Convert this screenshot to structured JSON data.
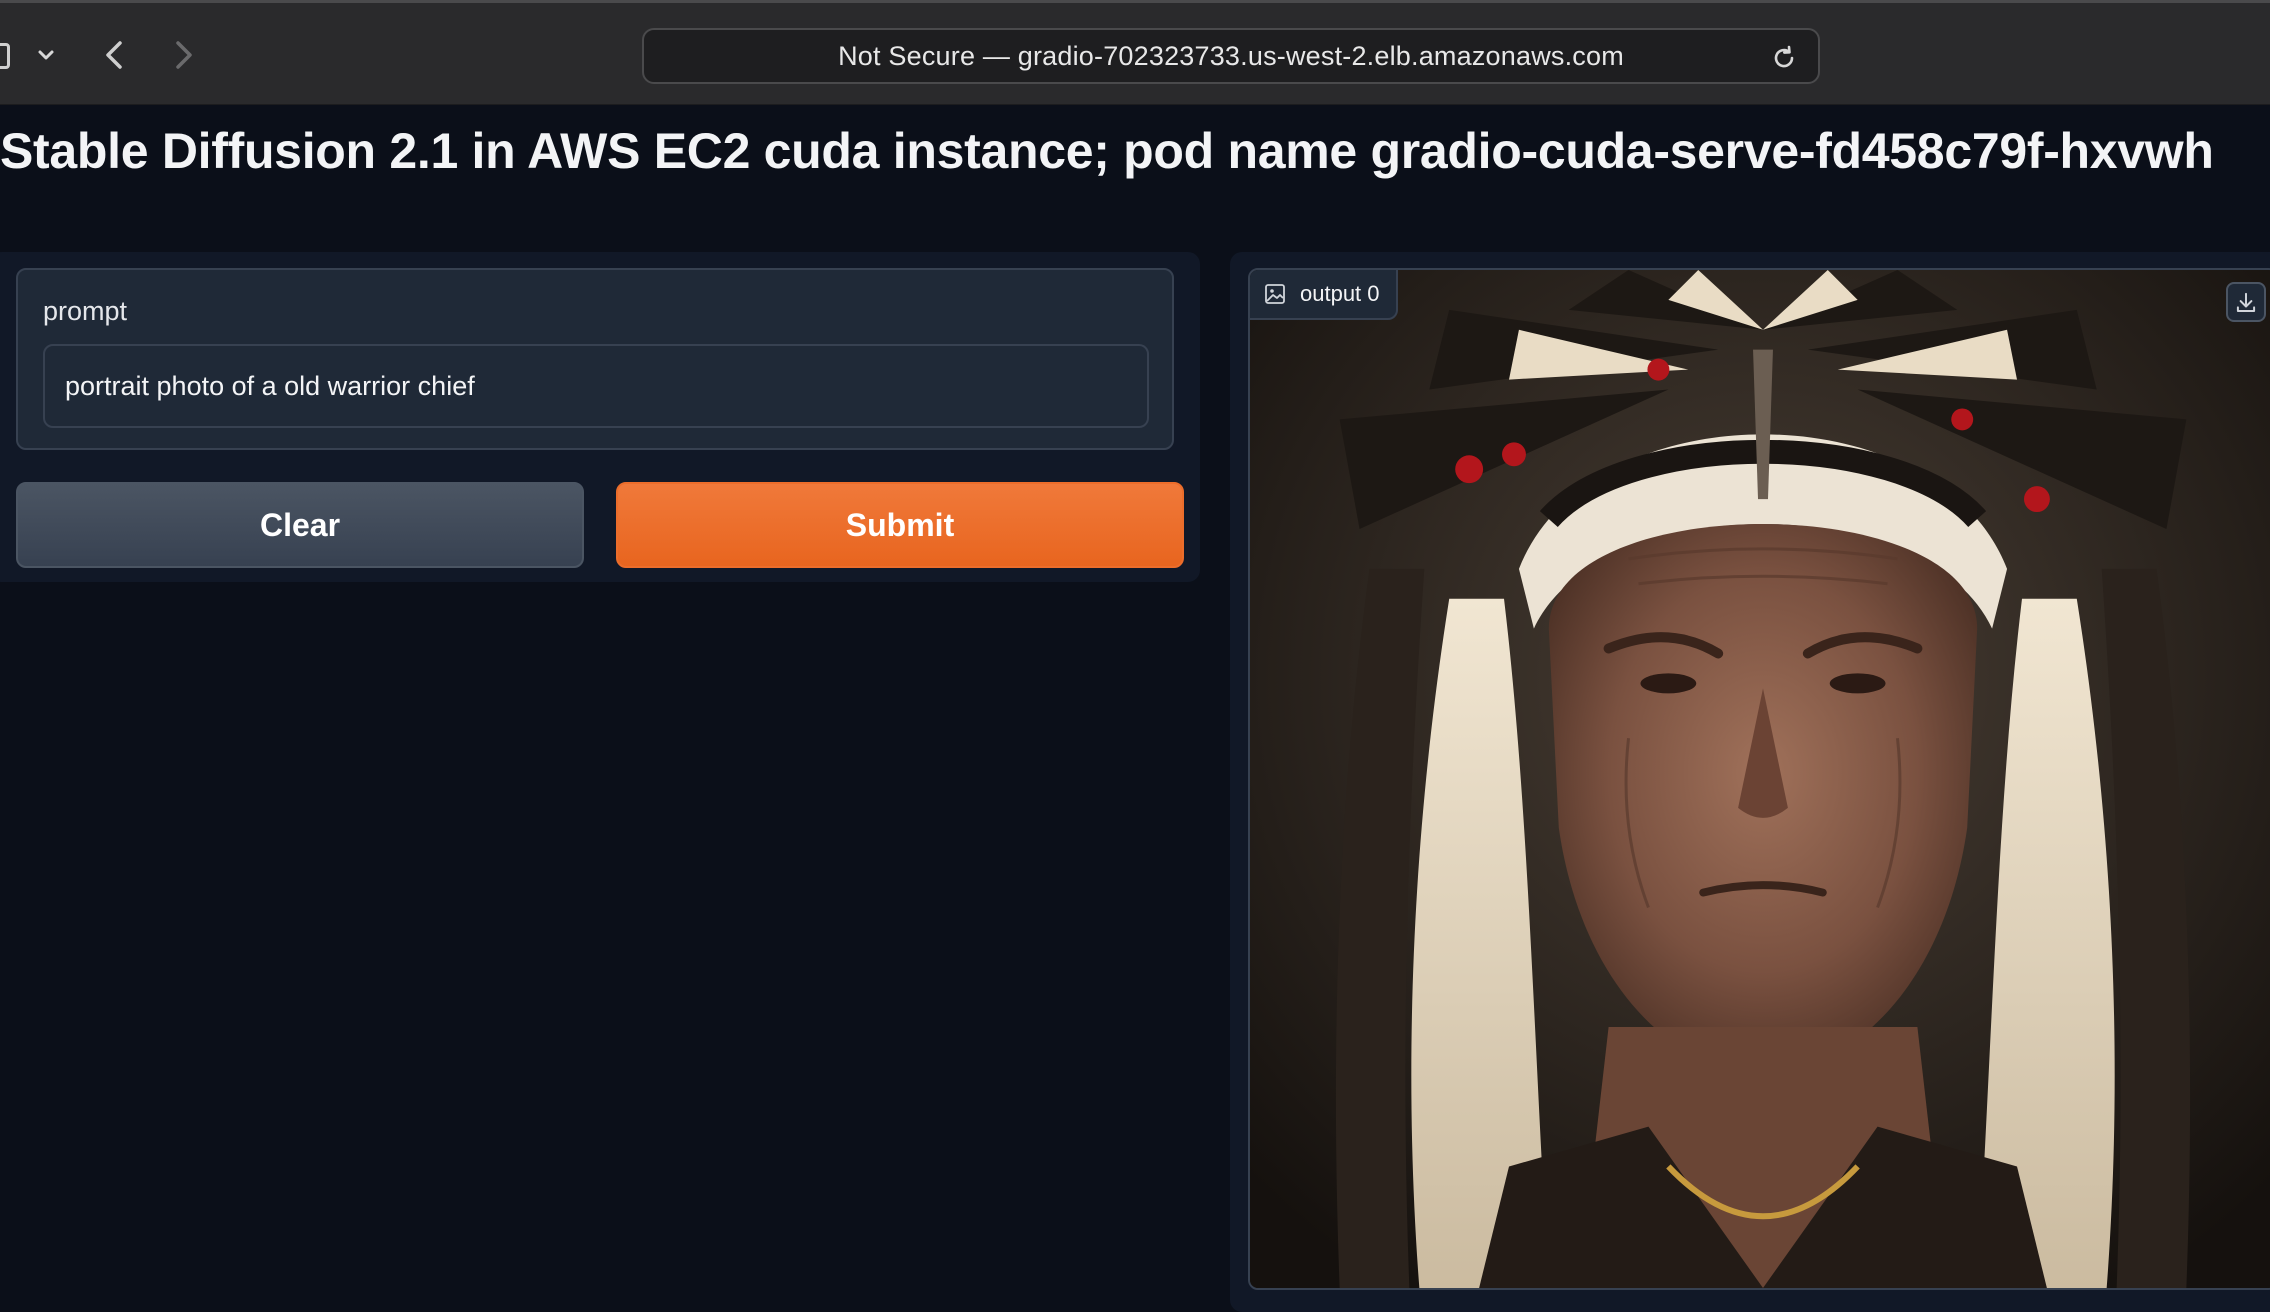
{
  "browser": {
    "url_text": "Not Secure — gradio-702323733.us-west-2.elb.amazonaws.com"
  },
  "page": {
    "title": "Stable Diffusion 2.1 in AWS EC2 cuda instance; pod name gradio-cuda-serve-fd458c79f-hxvwh"
  },
  "input_panel": {
    "prompt_label": "prompt",
    "prompt_value": "portrait photo of a old warrior chief",
    "clear_label": "Clear",
    "submit_label": "Submit"
  },
  "output_panel": {
    "label": "output 0",
    "image_subject": "portrait of an elderly man wearing a feathered headdress"
  },
  "colors": {
    "page_bg": "#0b0f19",
    "panel_bg": "#111827",
    "block_bg": "#1f2937",
    "submit_accent": "#e8651f",
    "clear_bg": "#4b5563"
  },
  "icons": {
    "back": "chevron-left-icon",
    "forward": "chevron-right-icon",
    "reload": "reload-icon",
    "tab_menu": "chevron-down-icon",
    "image": "image-icon",
    "download": "download-icon"
  }
}
